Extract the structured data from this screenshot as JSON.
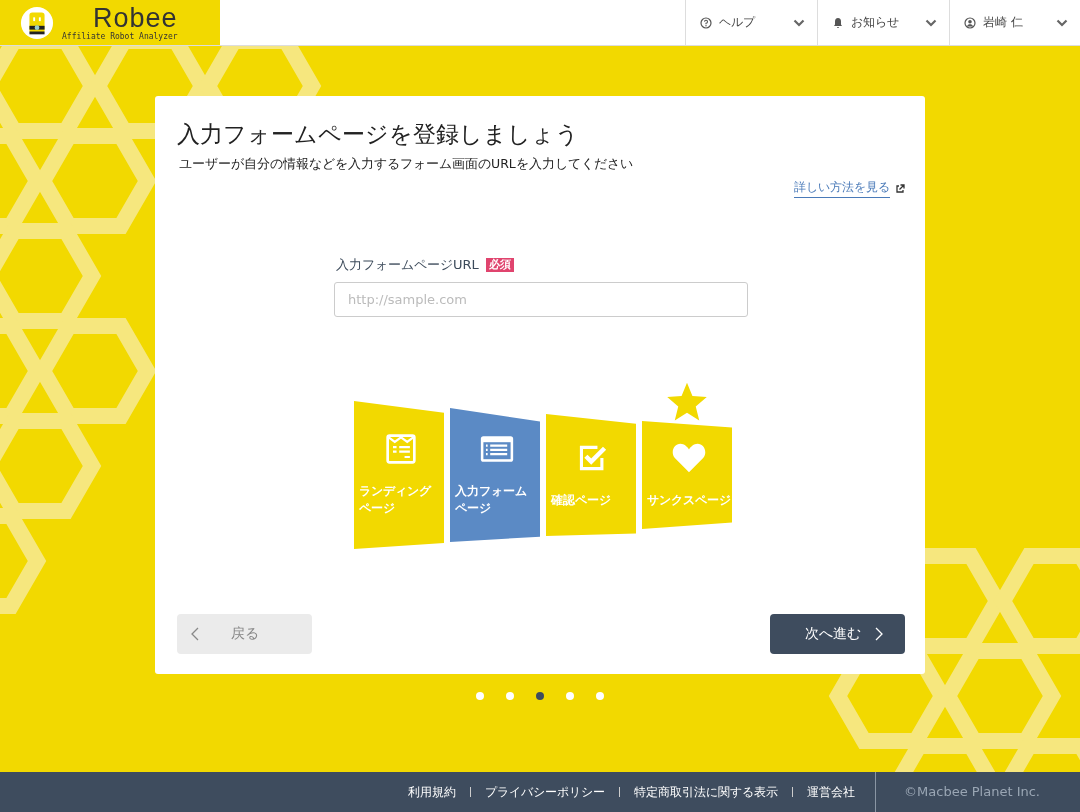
{
  "header": {
    "logo": {
      "name": "Robee",
      "tagline": "Affiliate Robot Analyzer"
    },
    "menus": [
      {
        "kind": "help",
        "label": "ヘルプ"
      },
      {
        "kind": "bell",
        "label": "お知らせ"
      },
      {
        "kind": "user",
        "label": "岩崎 仁"
      }
    ]
  },
  "card": {
    "title": "入力フォームページを登録しましょう",
    "subtitle": "ユーザーが自分の情報などを入力するフォーム画面のURLを入力してください",
    "help_link": "詳しい方法を見る",
    "field": {
      "label": "入力フォームページURL",
      "badge": "必須",
      "placeholder": "http://sample.com"
    },
    "steps": [
      {
        "kind": "landing",
        "label": [
          "ランディング",
          "ページ"
        ],
        "selected": false
      },
      {
        "kind": "form",
        "label": [
          "入力フォーム",
          "ページ"
        ],
        "selected": true
      },
      {
        "kind": "confirm",
        "label": [
          "確認ページ"
        ],
        "selected": false
      },
      {
        "kind": "thanks",
        "label": [
          "サンクスページ"
        ],
        "selected": false
      }
    ],
    "back_button": {
      "label": "戻る",
      "disabled": true
    },
    "next_button": {
      "label": "次へ進む",
      "disabled": false
    }
  },
  "pager": [
    {
      "selected": false
    },
    {
      "selected": false
    },
    {
      "selected": true
    },
    {
      "selected": false
    },
    {
      "selected": false
    }
  ],
  "footer": {
    "links": [
      "利用規約",
      "プライバシーポリシー",
      "特定商取引法に関する表示",
      "運営会社"
    ],
    "copyright": "©Macbee Planet Inc."
  }
}
